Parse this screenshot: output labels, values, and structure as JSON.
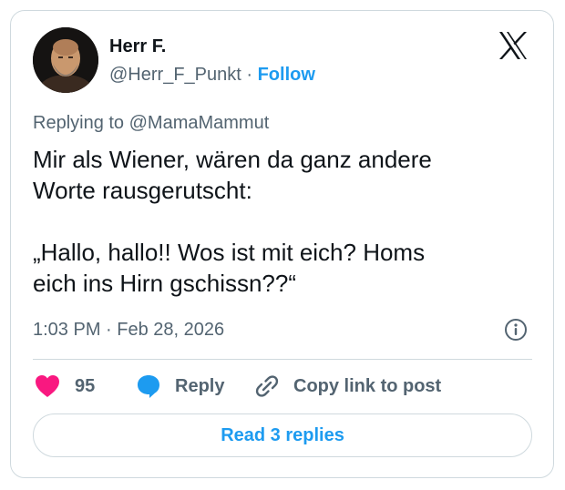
{
  "author": {
    "name": "Herr F.",
    "handle": "@Herr_F_Punkt",
    "separator": "·",
    "follow_label": "Follow"
  },
  "reply_to": "Replying to @MamaMammut",
  "tweet": {
    "line1": "Mir als Wiener, wären da ganz andere",
    "line2": "Worte rausgerutscht:",
    "line3": "„Hallo, hallo!! Wos ist mit eich? Homs",
    "line4": "eich ins Hirn gschissn??“"
  },
  "meta": {
    "time": "1:03 PM",
    "separator": "·",
    "date": "Feb 28, 2026"
  },
  "actions": {
    "like_count": "95",
    "reply_label": "Reply",
    "copy_link_label": "Copy link to post"
  },
  "read_replies_label": "Read 3 replies",
  "colors": {
    "accent": "#1d9bf0",
    "like": "#f91880",
    "text": "#0f1419",
    "secondary": "#536471",
    "border": "#cfd9de"
  },
  "icons": [
    "x-logo-icon",
    "info-icon",
    "heart-icon",
    "reply-bubble-icon",
    "link-icon"
  ]
}
